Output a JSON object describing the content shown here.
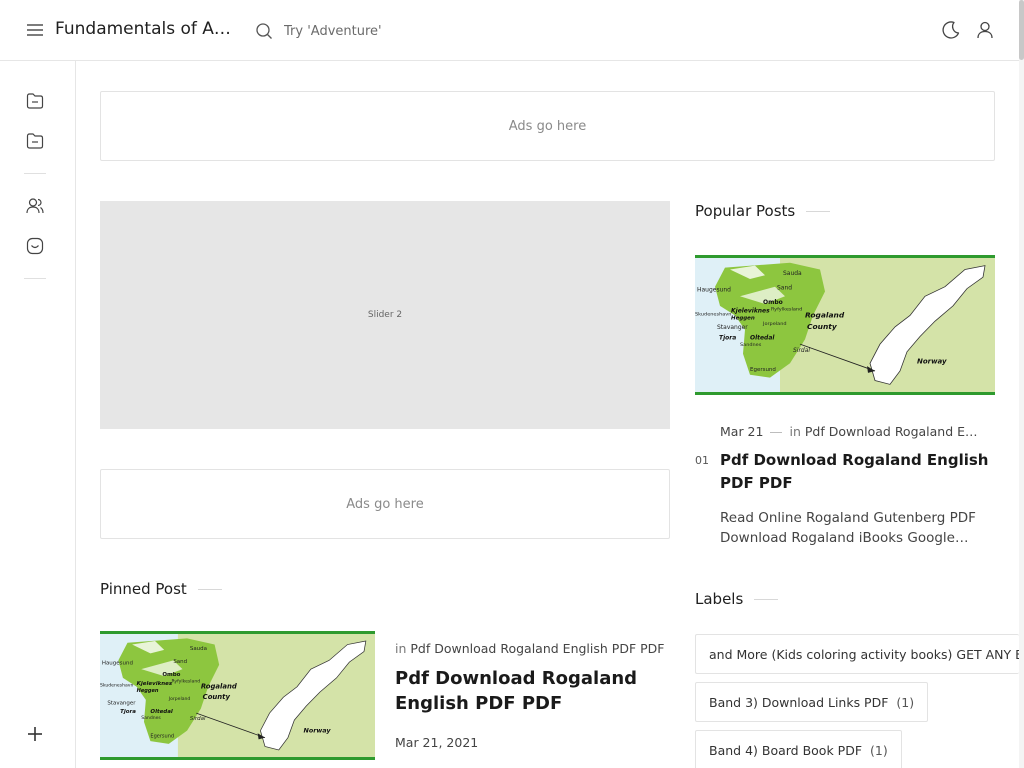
{
  "header": {
    "site_title": "Fundamentals of Aut…",
    "search_placeholder": "Try 'Adventure'"
  },
  "ads": {
    "top": "Ads go here",
    "middle": "Ads go here"
  },
  "slider": {
    "label": "Slider 2"
  },
  "map_labels": {
    "haugesund": "Haugesund",
    "sauda": "Sauda",
    "sand": "Sand",
    "kvitsoy": "Kjeleviknes",
    "ombo": "Ombo",
    "ryfylke": "Ryfylkesland",
    "rogaland": "Rogaland",
    "county": "County",
    "stavanger": "Stavanger",
    "tjora": "Tjora",
    "oltedal": "Oltedal",
    "sandnes": "Sandnes",
    "sirdal": "Sirdal",
    "egersund": "Egersund",
    "norway": "Norway",
    "hoggen": "Heggen",
    "jorpeland": "Jorpeland",
    "skudeneshavn": "Skudeneshavn"
  },
  "popular": {
    "title": "Popular Posts",
    "items": [
      {
        "rank": "01",
        "date": "Mar 21",
        "in": "in",
        "category": "Pdf Download Rogaland E…",
        "title": "Pdf Download Rogaland English PDF PDF",
        "snippet": "Read Online Rogaland Gutenberg PDF Download Rogaland iBooks Google…"
      }
    ]
  },
  "pinned": {
    "title": "Pinned Post",
    "in": "in",
    "category": "Pdf Download Rogaland English PDF PDF",
    "post_title": "Pdf Download Rogaland English PDF PDF",
    "date": "Mar 21, 2021"
  },
  "labels": {
    "title": "Labels",
    "items": [
      {
        "name": "and More (Kids coloring activity books) GET ANY BOOK FAST PDF",
        "count": ""
      },
      {
        "name": "Band 3) Download Links PDF",
        "count": "(1)"
      },
      {
        "name": "Band 4) Board Book PDF",
        "count": "(1)"
      }
    ]
  },
  "colors": {
    "accent_green": "#2e9a2e",
    "map_land": "#8dc63f",
    "map_bg": "#d4e3a8"
  },
  "icons": {
    "menu": "menu-icon",
    "search": "search-icon",
    "theme": "moon-icon",
    "account": "user-icon",
    "sidebar": [
      "folder-icon",
      "folder-icon",
      "users-icon",
      "smile-icon",
      "plus-icon"
    ]
  }
}
